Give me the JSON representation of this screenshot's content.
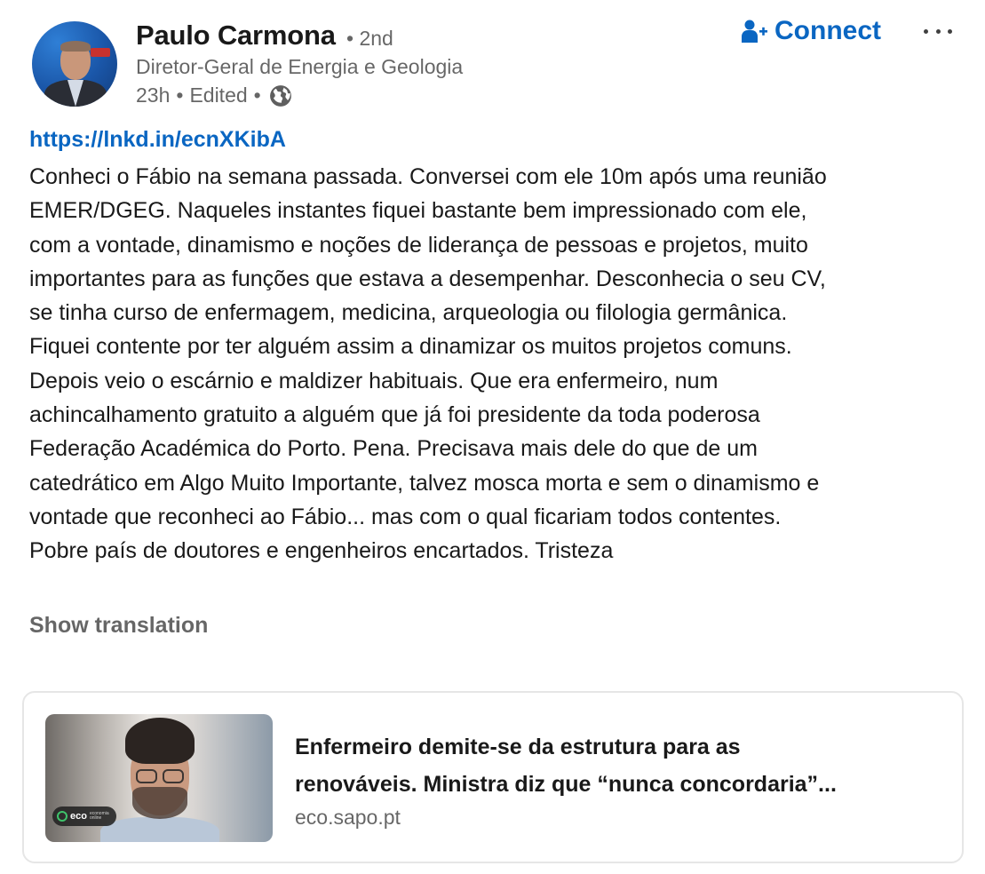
{
  "author": {
    "name": "Paulo Carmona",
    "degree": "• 2nd",
    "headline": "Diretor-Geral de Energia e Geologia",
    "time": "23h",
    "separator": "•",
    "edited": "Edited",
    "visibility_icon": "globe-icon"
  },
  "actions": {
    "connect_label": "Connect",
    "connect_icon": "add-person-icon",
    "more_icon": "more-horizontal-icon"
  },
  "post": {
    "link": "https://lnkd.in/ecnXKibA",
    "lines": [
      "Conheci o Fábio na semana passada. Conversei com ele 10m após uma reunião",
      "EMER/DGEG. Naqueles instantes fiquei bastante bem impressionado com ele,",
      "com a vontade, dinamismo e noções de liderança de pessoas e projetos, muito",
      "importantes para as funções que estava a desempenhar. Desconhecia o seu CV,",
      "se tinha curso de enfermagem, medicina, arqueologia ou filologia germânica.",
      "Fiquei contente por ter alguém assim a dinamizar os muitos projetos comuns.",
      "Depois veio o escárnio e maldizer habituais. Que era enfermeiro, num",
      "achincalhamento gratuito a alguém que já foi presidente da toda poderosa",
      "Federação Académica do Porto. Pena. Precisava mais dele do que de um",
      "catedrático em Algo Muito Importante, talvez mosca morta e sem o dinamismo e",
      "vontade que reconheci ao Fábio... mas com o qual ficariam todos contentes.",
      "Pobre país de doutores e engenheiros encartados. Tristeza"
    ],
    "show_translation": "Show translation"
  },
  "article": {
    "title_line1": "Enfermeiro demite-se da estrutura para as",
    "title_line2": "renováveis. Ministra diz que “nunca concordaria”...",
    "source": "eco.sapo.pt",
    "thumb_badge": "eco",
    "thumb_badge_small_1": "economia",
    "thumb_badge_small_2": "online"
  },
  "colors": {
    "link_blue": "#0a66c2",
    "text_primary": "rgba(0,0,0,0.9)",
    "text_secondary": "rgba(0,0,0,0.6)",
    "card_border": "#e6e6e6",
    "eco_green": "#3fc36b"
  }
}
